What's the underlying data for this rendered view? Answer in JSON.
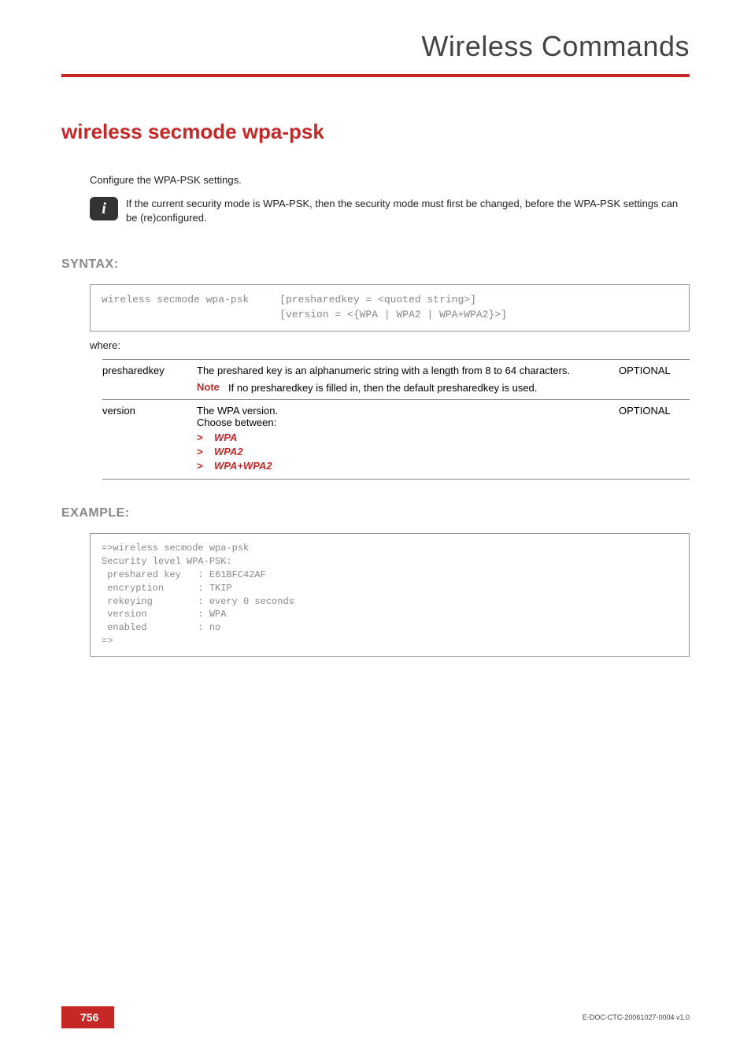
{
  "header": {
    "title": "Wireless Commands"
  },
  "command": {
    "title": "wireless secmode wpa-psk"
  },
  "intro": "Configure the WPA-PSK settings.",
  "info_note": "If the current security mode is WPA-PSK, then the security mode must first be changed, before the WPA-PSK settings can be (re)configured.",
  "sections": {
    "syntax_heading": "SYNTAX:",
    "example_heading": "EXAMPLE:",
    "where": "where:"
  },
  "syntax_box": "wireless secmode wpa-psk     [presharedkey = <quoted string>]\n                             [version = <{WPA | WPA2 | WPA+WPA2}>]",
  "params": {
    "row1": {
      "name": "presharedkey",
      "desc": "The preshared key is an alphanumeric string with a length from 8 to 64 characters.",
      "note_label": "Note",
      "note_text": "If no presharedkey is filled in, then the default presharedkey is used.",
      "optional": "OPTIONAL"
    },
    "row2": {
      "name": "version",
      "desc1": "The WPA version.",
      "desc2": "Choose between:",
      "opt1": "WPA",
      "opt2": "WPA2",
      "opt3": "WPA+WPA2",
      "optional": "OPTIONAL"
    }
  },
  "example_box": "=>wireless secmode wpa-psk\nSecurity level WPA-PSK:\n preshared key   : E61BFC42AF\n encryption      : TKIP\n rekeying        : every 0 seconds\n version         : WPA\n enabled         : no\n=>",
  "footer": {
    "page": "756",
    "docid": "E-DOC-CTC-20061027-0004 v1.0"
  }
}
